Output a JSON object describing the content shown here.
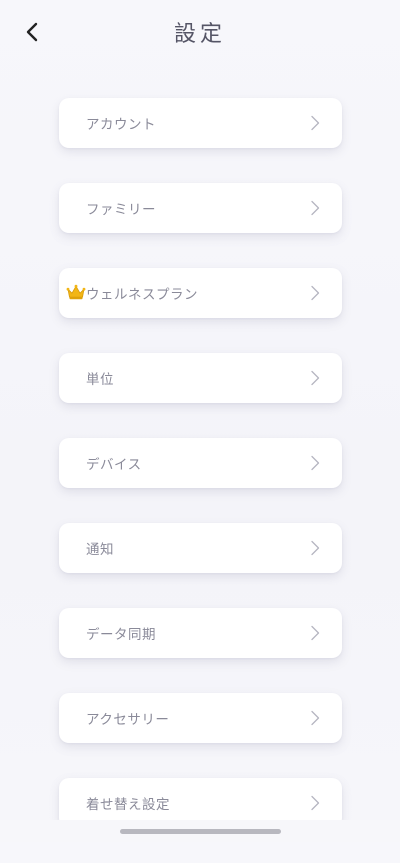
{
  "header": {
    "title": "設定",
    "back_icon": "chevron-left-icon"
  },
  "menu": {
    "items": [
      {
        "label": "アカウント",
        "icon": "chevron-right-icon"
      },
      {
        "label": "ファミリー",
        "icon": "chevron-right-icon"
      },
      {
        "label": "ウェルネスプラン",
        "icon": "chevron-right-icon",
        "badge_icon": "crown-icon"
      },
      {
        "label": "単位",
        "icon": "chevron-right-icon"
      },
      {
        "label": "デバイス",
        "icon": "chevron-right-icon"
      },
      {
        "label": "通知",
        "icon": "chevron-right-icon"
      },
      {
        "label": "データ同期",
        "icon": "chevron-right-icon"
      },
      {
        "label": "アクセサリー",
        "icon": "chevron-right-icon"
      },
      {
        "label": "着せ替え設定",
        "icon": "chevron-right-icon"
      }
    ]
  },
  "colors": {
    "background": "#f5f5fa",
    "card": "#ffffff",
    "label": "#8a8a99",
    "title": "#555566",
    "crown": "#f2b616"
  }
}
